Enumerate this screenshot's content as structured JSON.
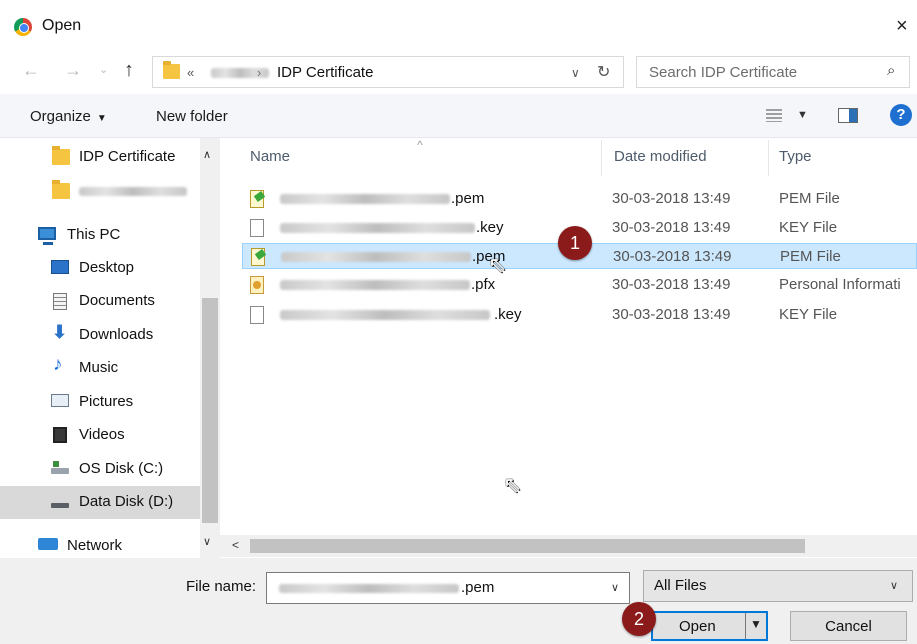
{
  "window": {
    "title": "Open",
    "close_glyph": "×"
  },
  "nav": {
    "back_glyph": "←",
    "forward_glyph": "→",
    "recent_glyph": "⌄",
    "up_glyph": "↑",
    "address_prefix": "«",
    "address_sep": "›",
    "address_crumb": "IDP Certificate",
    "dropdown_glyph": "∨",
    "refresh_glyph": "↻",
    "search_placeholder": "Search IDP Certificate",
    "search_glyph": "⌕"
  },
  "toolbar": {
    "organize_label": "Organize",
    "organize_caret": "▼",
    "new_folder_label": "New folder",
    "view_caret": "▼",
    "help_glyph": "?"
  },
  "sidebar": {
    "scroll_up": "∧",
    "scroll_down": "∨",
    "items": [
      {
        "label": "IDP Certificate",
        "icon": "folder-icon"
      },
      {
        "label": "",
        "icon": "folder-icon"
      },
      {
        "label": "This PC",
        "icon": "computer-icon"
      },
      {
        "label": "Desktop",
        "icon": "desktop-icon"
      },
      {
        "label": "Documents",
        "icon": "documents-icon"
      },
      {
        "label": "Downloads",
        "icon": "download-arrow-icon"
      },
      {
        "label": "Music",
        "icon": "music-note-icon"
      },
      {
        "label": "Pictures",
        "icon": "pictures-icon"
      },
      {
        "label": "Videos",
        "icon": "video-icon"
      },
      {
        "label": "OS Disk (C:)",
        "icon": "drive-icon"
      },
      {
        "label": "Data Disk (D:)",
        "icon": "drive-icon"
      },
      {
        "label": "Network",
        "icon": "network-icon"
      }
    ]
  },
  "filelist": {
    "sort_glyph": "^",
    "columns": {
      "name": "Name",
      "date": "Date modified",
      "type": "Type"
    },
    "rows": [
      {
        "suffix": ".pem",
        "date": "30-03-2018 13:49",
        "type": "PEM File",
        "icon": "certificate-file-icon"
      },
      {
        "suffix": ".key",
        "date": "30-03-2018 13:49",
        "type": "KEY File",
        "icon": "blank-file-icon"
      },
      {
        "suffix": ".pem",
        "date": "30-03-2018 13:49",
        "type": "PEM File",
        "icon": "certificate-file-icon"
      },
      {
        "suffix": ".pfx",
        "date": "30-03-2018 13:49",
        "type": "Personal Informati",
        "icon": "pfx-file-icon"
      },
      {
        "suffix": ".key",
        "date": "30-03-2018 13:49",
        "type": "KEY File",
        "icon": "blank-file-icon"
      }
    ],
    "selected_row": 2
  },
  "annotations": {
    "step1": "1",
    "step2": "2"
  },
  "cursor_glyph": "⇖",
  "footer": {
    "file_name_label": "File name:",
    "file_name_suffix": ".pem",
    "file_name_dropdown": "∨",
    "filter_label": "All Files",
    "filter_dropdown": "∨",
    "open_label": "Open",
    "open_split_arrow": "▼",
    "cancel_label": "Cancel"
  },
  "hscroll": {
    "left_glyph": "<"
  }
}
